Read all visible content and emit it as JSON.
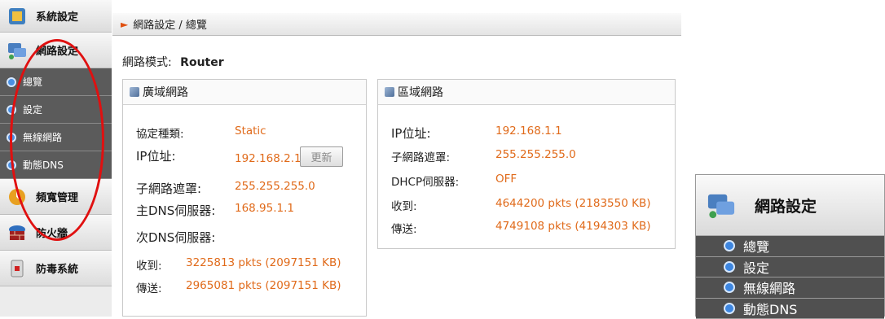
{
  "sidebar": {
    "groups": [
      {
        "label": "系統設定",
        "icon": "system-settings-icon"
      },
      {
        "label": "網路設定",
        "icon": "network-settings-icon"
      },
      {
        "label": "頻寬管理",
        "icon": "bandwidth-icon"
      },
      {
        "label": "防火牆",
        "icon": "firewall-icon"
      },
      {
        "label": "防毒系統",
        "icon": "antivirus-icon"
      }
    ],
    "network_items": [
      {
        "label": "總覽"
      },
      {
        "label": "設定"
      },
      {
        "label": "無線網路"
      },
      {
        "label": "動態DNS"
      }
    ]
  },
  "breadcrumb": "網路設定 / 總覽",
  "network_mode": {
    "label": "網路模式:",
    "value": "Router"
  },
  "wan": {
    "title": "廣域網路",
    "rows": [
      {
        "label": "協定種類:",
        "value": "Static"
      },
      {
        "label": "IP位址:",
        "value": "192.168.2.1"
      },
      {
        "label": "子網路遮罩:",
        "value": "255.255.255.0"
      },
      {
        "label": "主DNS伺服器:",
        "value": "168.95.1.1"
      },
      {
        "label": "次DNS伺服器:",
        "value": ""
      },
      {
        "label": "收到:",
        "value": "3225813 pkts (2097151 KB)"
      },
      {
        "label": "傳送:",
        "value": "2965081 pkts (2097151 KB)"
      }
    ],
    "refresh_label": "更新"
  },
  "lan": {
    "title": "區域網路",
    "rows": [
      {
        "label": "IP位址:",
        "value": "192.168.1.1"
      },
      {
        "label": "子網路遮罩:",
        "value": "255.255.255.0"
      },
      {
        "label": "DHCP伺服器:",
        "value": "OFF"
      },
      {
        "label": "收到:",
        "value": "4644200 pkts (2183550 KB)"
      },
      {
        "label": "傳送:",
        "value": "4749108 pkts (4194303 KB)"
      }
    ]
  },
  "zoom_panel": {
    "title": "網路設定",
    "items": [
      {
        "label": "總覽"
      },
      {
        "label": "設定"
      },
      {
        "label": "無線網路"
      },
      {
        "label": "動態DNS"
      }
    ]
  },
  "colors": {
    "value_orange": "#e06a1a",
    "sub_menu_bg": "#5b5b5b",
    "highlight_oval": "#e01010"
  }
}
